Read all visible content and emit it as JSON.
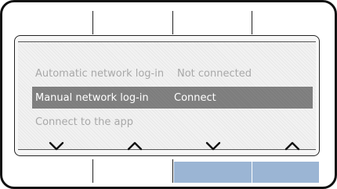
{
  "menu": {
    "rows": [
      {
        "label": "Automatic network log-in",
        "value": "Not connected",
        "state": "dimmed"
      },
      {
        "label": "Manual network log-in",
        "value": "Connect",
        "state": "selected"
      },
      {
        "label": "Connect to the app",
        "value": "",
        "state": "dimmed"
      }
    ]
  },
  "softkeys": [
    {
      "icon": "chevron-down-icon"
    },
    {
      "icon": "chevron-up-icon"
    },
    {
      "icon": "chevron-down-icon"
    },
    {
      "icon": "chevron-up-icon"
    }
  ],
  "colors": {
    "selected_row_bg": "#7d7d7d",
    "dimmed_text": "#a8a8a8",
    "active_softkey": "#9bb5d4",
    "frame": "#111111"
  }
}
